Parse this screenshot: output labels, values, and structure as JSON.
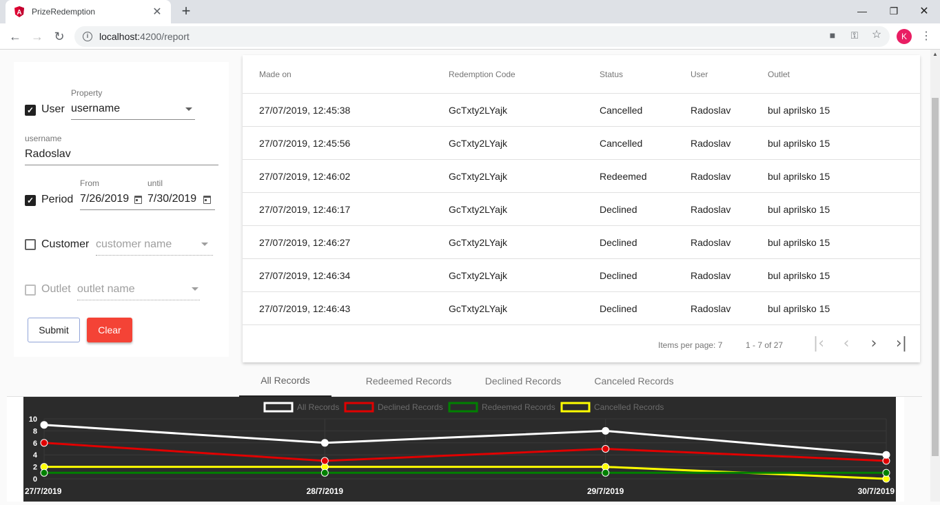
{
  "browser": {
    "tab_title": "PrizeRedemption",
    "url_host": "localhost:",
    "url_path": "4200/report",
    "profile_initial": "K"
  },
  "filters": {
    "user": {
      "checked": true,
      "label": "User",
      "property_label": "Property",
      "property_value": "username"
    },
    "username": {
      "label": "username",
      "value": "Radoslav"
    },
    "period": {
      "checked": true,
      "label": "Period",
      "from_label": "From",
      "from_value": "7/26/2019",
      "until_label": "until",
      "until_value": "7/30/2019"
    },
    "customer": {
      "checked": false,
      "label": "Customer",
      "placeholder": "customer name"
    },
    "outlet": {
      "checked": false,
      "label": "Outlet",
      "placeholder": "outlet name"
    },
    "submit_label": "Submit",
    "clear_label": "Clear"
  },
  "table": {
    "columns": [
      "Made on",
      "Redemption Code",
      "Status",
      "User",
      "Outlet"
    ],
    "rows": [
      [
        "27/07/2019, 12:45:38",
        "GcTxty2LYajk",
        "Cancelled",
        "Radoslav",
        "bul aprilsko 15"
      ],
      [
        "27/07/2019, 12:45:56",
        "GcTxty2LYajk",
        "Cancelled",
        "Radoslav",
        "bul aprilsko 15"
      ],
      [
        "27/07/2019, 12:46:02",
        "GcTxty2LYajk",
        "Redeemed",
        "Radoslav",
        "bul aprilsko 15"
      ],
      [
        "27/07/2019, 12:46:17",
        "GcTxty2LYajk",
        "Declined",
        "Radoslav",
        "bul aprilsko 15"
      ],
      [
        "27/07/2019, 12:46:27",
        "GcTxty2LYajk",
        "Declined",
        "Radoslav",
        "bul aprilsko 15"
      ],
      [
        "27/07/2019, 12:46:34",
        "GcTxty2LYajk",
        "Declined",
        "Radoslav",
        "bul aprilsko 15"
      ],
      [
        "27/07/2019, 12:46:43",
        "GcTxty2LYajk",
        "Declined",
        "Radoslav",
        "bul aprilsko 15"
      ]
    ]
  },
  "paginator": {
    "items_per_page": "Items per page: 7",
    "range": "1 - 7 of 27"
  },
  "tabs": [
    {
      "label": "All Records",
      "active": true
    },
    {
      "label": "Redeemed Records",
      "active": false
    },
    {
      "label": "Declined Records",
      "active": false
    },
    {
      "label": "Canceled Records",
      "active": false
    }
  ],
  "chart_data": {
    "type": "line",
    "categories": [
      "27/7/2019",
      "28/7/2019",
      "29/7/2019",
      "30/7/2019"
    ],
    "series": [
      {
        "name": "All Records",
        "values": [
          9,
          6,
          8,
          4
        ],
        "color": "#ffffff"
      },
      {
        "name": "Declined Records",
        "values": [
          6,
          3,
          5,
          3
        ],
        "color": "#e00000"
      },
      {
        "name": "Redeemed Records",
        "values": [
          1,
          1,
          1,
          1
        ],
        "color": "#008000"
      },
      {
        "name": "Cancelled Records",
        "values": [
          2,
          2,
          2,
          0
        ],
        "color": "#ffff00"
      }
    ],
    "y_ticks": [
      "10",
      "8",
      "6",
      "4",
      "2",
      "0"
    ],
    "ylim": [
      0,
      10
    ],
    "legend_position": "top",
    "background": "#2b2b2b"
  }
}
